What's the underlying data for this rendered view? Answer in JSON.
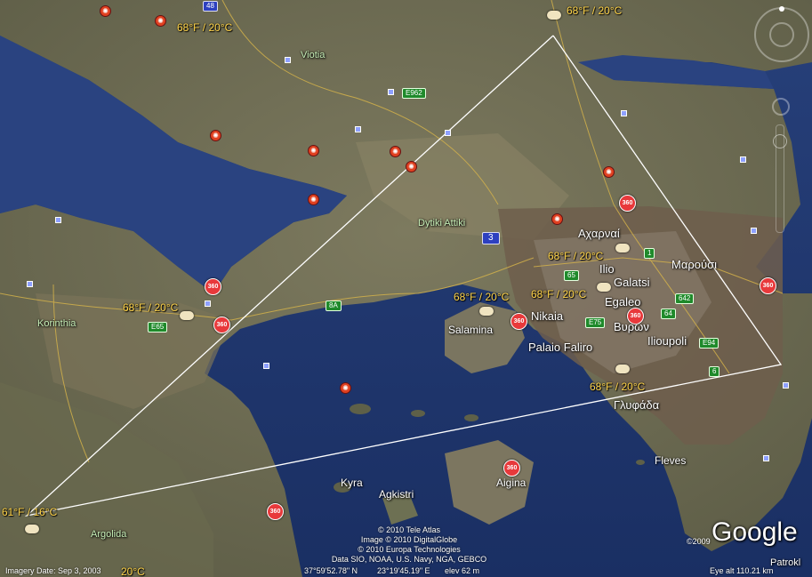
{
  "map": {
    "places": [
      {
        "key": "viotia",
        "text": "Viotia"
      },
      {
        "key": "dytiki",
        "text": "Dytiki Attiki"
      },
      {
        "key": "korinthia",
        "text": "Korinthia"
      },
      {
        "key": "salamina",
        "text": "Salamina"
      },
      {
        "key": "acharnai",
        "text": "Αχαρναί"
      },
      {
        "key": "ilio",
        "text": "Ilio"
      },
      {
        "key": "marousi",
        "text": "Μαρούσι"
      },
      {
        "key": "galatsi",
        "text": "Galatsi"
      },
      {
        "key": "egaleo",
        "text": "Egaleo"
      },
      {
        "key": "nikaia",
        "text": "Nikaia"
      },
      {
        "key": "vyron",
        "text": "Βυρων"
      },
      {
        "key": "iliioupoli",
        "text": "Ilioupoli"
      },
      {
        "key": "palaio",
        "text": "Palaio Faliro"
      },
      {
        "key": "glyfada",
        "text": "Γλυφάδα"
      },
      {
        "key": "fleves",
        "text": "Fleves"
      },
      {
        "key": "kyra",
        "text": "Kyra"
      },
      {
        "key": "agkistri",
        "text": "Agkistri"
      },
      {
        "key": "aigina",
        "text": "Aigina"
      },
      {
        "key": "argolida",
        "text": "Argolida"
      },
      {
        "key": "patrokl",
        "text": "Patrokl"
      }
    ],
    "weather": [
      {
        "key": "w1",
        "text": "68°F / 20°C"
      },
      {
        "key": "w2",
        "text": "68°F / 20°C"
      },
      {
        "key": "w3",
        "text": "68°F / 20°C"
      },
      {
        "key": "w4",
        "text": "68°F / 20°C"
      },
      {
        "key": "w5",
        "text": "68°F / 20°C"
      },
      {
        "key": "w6",
        "text": "68°F / 20°C"
      },
      {
        "key": "w7",
        "text": "68°F / 20°C"
      },
      {
        "key": "w8",
        "text": "61°F / 16°C"
      },
      {
        "key": "w9",
        "text": "20°C"
      }
    ],
    "roads": [
      {
        "key": "r48",
        "text": "48"
      },
      {
        "key": "e962",
        "text": "E962"
      },
      {
        "key": "r3",
        "text": "3"
      },
      {
        "key": "r1",
        "text": "1"
      },
      {
        "key": "r65",
        "text": "65"
      },
      {
        "key": "e75",
        "text": "E75"
      },
      {
        "key": "r64",
        "text": "64"
      },
      {
        "key": "r642",
        "text": "642"
      },
      {
        "key": "e94",
        "text": "E94"
      },
      {
        "key": "r6",
        "text": "6"
      },
      {
        "key": "r8a",
        "text": "8A"
      },
      {
        "key": "e65",
        "text": "E65"
      }
    ],
    "pin_label": "360",
    "radio_symbol": "✺",
    "triangle_color": "#ffffff"
  },
  "attribution": [
    "© 2010 Tele Atlas",
    "Image © 2010 DigitalGlobe",
    "© 2010 Europa Technologies",
    "Data SIO, NOAA, U.S. Navy, NGA, GEBCO"
  ],
  "copyright_small": "©2009",
  "logo": "Google",
  "status": {
    "imagery_date": "Imagery Date: Sep 3, 2003",
    "lat": "37°59'52.78\" N",
    "lon": "23°19'45.19\" E",
    "elev": "elev   62 m",
    "eye_alt": "Eye alt   110.21 km"
  }
}
